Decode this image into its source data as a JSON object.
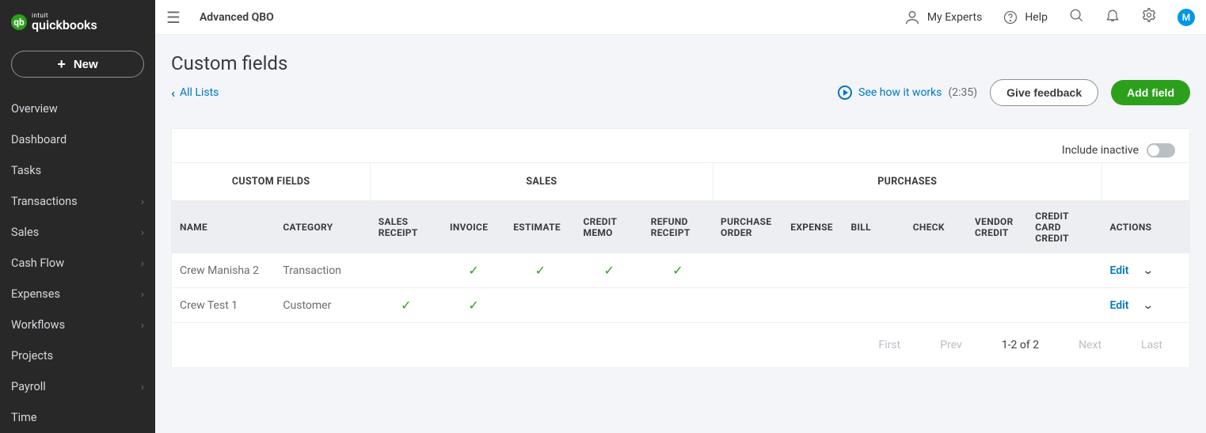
{
  "brand": {
    "intuit": "intuit",
    "product": "quickbooks",
    "logo_letter": "qb"
  },
  "sidebar": {
    "new_label": "New",
    "items": [
      {
        "label": "Overview",
        "expandable": false
      },
      {
        "label": "Dashboard",
        "expandable": false
      },
      {
        "label": "Tasks",
        "expandable": false
      },
      {
        "label": "Transactions",
        "expandable": true
      },
      {
        "label": "Sales",
        "expandable": true
      },
      {
        "label": "Cash Flow",
        "expandable": true
      },
      {
        "label": "Expenses",
        "expandable": true
      },
      {
        "label": "Workflows",
        "expandable": true
      },
      {
        "label": "Projects",
        "expandable": false
      },
      {
        "label": "Payroll",
        "expandable": true
      },
      {
        "label": "Time",
        "expandable": false
      }
    ]
  },
  "header": {
    "company_name": "Advanced QBO",
    "my_experts": "My Experts",
    "help": "Help",
    "avatar_initial": "M"
  },
  "page": {
    "title": "Custom fields",
    "all_lists": "All Lists",
    "how_it_works": "See how it works",
    "duration": "(2:35)",
    "feedback_btn": "Give feedback",
    "add_btn": "Add field",
    "include_inactive": "Include inactive"
  },
  "table": {
    "group_headers": {
      "custom_fields": "CUSTOM FIELDS",
      "sales": "SALES",
      "purchases": "PURCHASES"
    },
    "columns": {
      "name": "NAME",
      "category": "CATEGORY",
      "sales_receipt": "SALES RECEIPT",
      "invoice": "INVOICE",
      "estimate": "ESTIMATE",
      "credit_memo": "CREDIT MEMO",
      "refund_receipt": "REFUND RECEIPT",
      "purchase_order": "PURCHASE ORDER",
      "expense": "EXPENSE",
      "bill": "BILL",
      "check": "CHECK",
      "vendor_credit": "VENDOR CREDIT",
      "credit_card_credit": "CREDIT CARD CREDIT",
      "actions": "ACTIONS"
    },
    "rows": [
      {
        "name": "Crew Manisha 2",
        "category": "Transaction",
        "sales_receipt": false,
        "invoice": true,
        "estimate": true,
        "credit_memo": true,
        "refund_receipt": true,
        "purchase_order": false,
        "expense": false,
        "bill": false,
        "check": false,
        "vendor_credit": false,
        "credit_card_credit": false,
        "action": "Edit"
      },
      {
        "name": "Crew Test 1",
        "category": "Customer",
        "sales_receipt": true,
        "invoice": true,
        "estimate": false,
        "credit_memo": false,
        "refund_receipt": false,
        "purchase_order": false,
        "expense": false,
        "bill": false,
        "check": false,
        "vendor_credit": false,
        "credit_card_credit": false,
        "action": "Edit"
      }
    ]
  },
  "pager": {
    "first": "First",
    "prev": "Prev",
    "range": "1-2 of 2",
    "next": "Next",
    "last": "Last"
  }
}
